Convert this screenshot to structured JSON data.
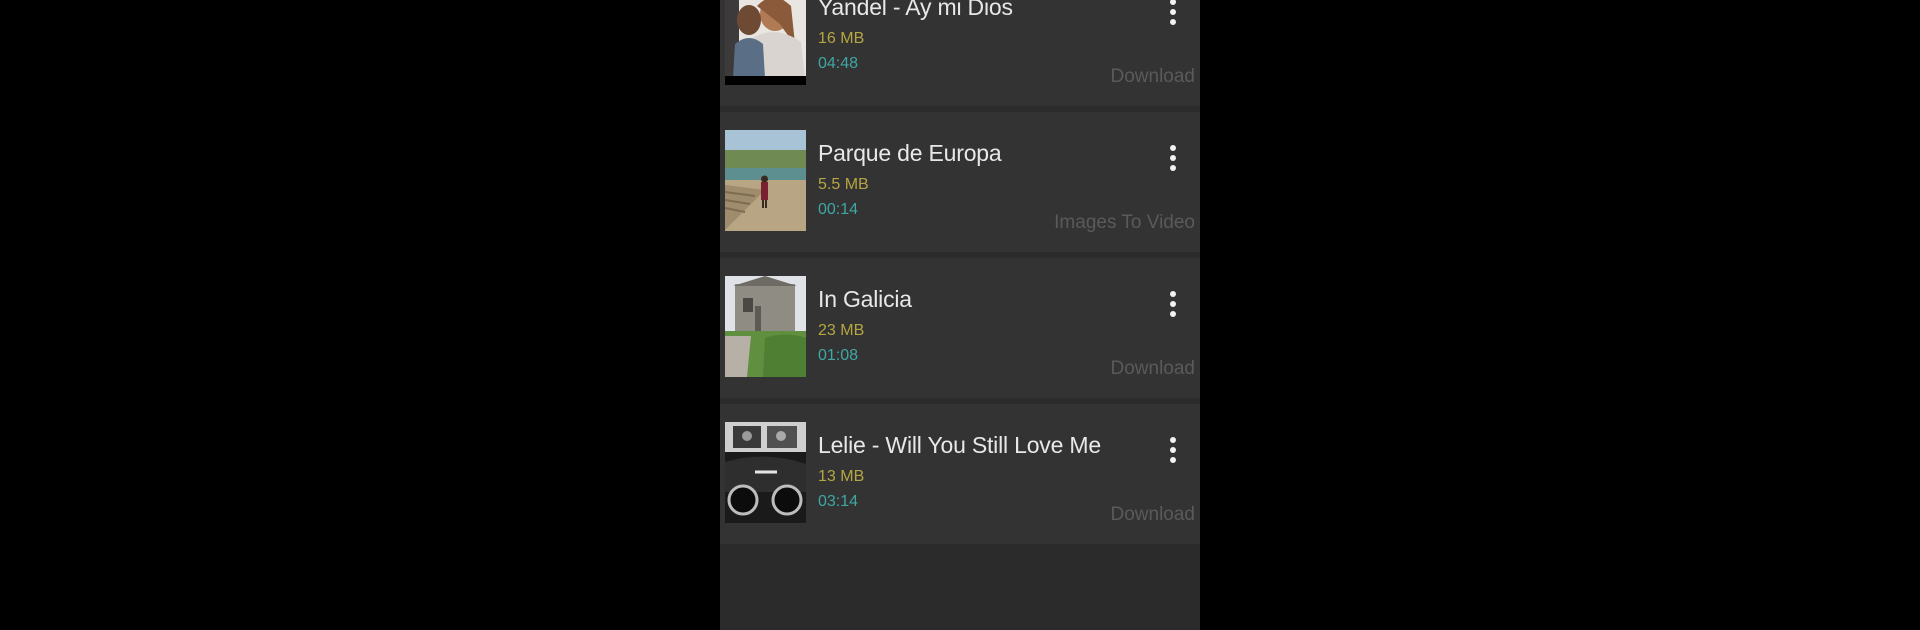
{
  "items": [
    {
      "title": "Yandel - Ay mi Dios",
      "size": "16 MB",
      "duration": "04:48",
      "tag": "Download",
      "thumb": "couple-portrait"
    },
    {
      "title": "Parque de Europa",
      "size": "5.5 MB",
      "duration": "00:14",
      "tag": "Images To Video",
      "thumb": "park-landscape"
    },
    {
      "title": "In Galicia",
      "size": "23 MB",
      "duration": "01:08",
      "tag": "Download",
      "thumb": "stone-house"
    },
    {
      "title": "Lelie - Will You Still Love Me",
      "size": "13 MB",
      "duration": "03:14",
      "tag": "Download",
      "thumb": "black-white-car"
    }
  ],
  "icons": {
    "menu": "more-vertical-icon"
  },
  "colors": {
    "background": "#000000",
    "list_background": "#2b2b2b",
    "card_background": "#333333",
    "title": "#e8e8e8",
    "size": "#b5a642",
    "duration": "#3fa7a4",
    "tag": "#5a5a5a"
  }
}
